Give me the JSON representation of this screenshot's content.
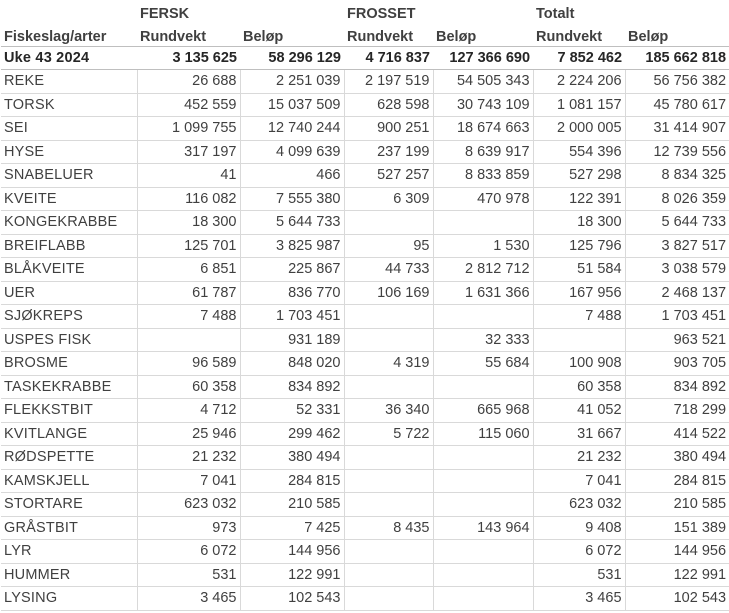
{
  "header": {
    "groups": [
      "FERSK",
      "FROSSET",
      "Totalt"
    ],
    "category_label": "Fiskeslag/arter",
    "sub_labels": [
      "Rundvekt",
      "Beløp",
      "Rundvekt",
      "Beløp",
      "Rundvekt",
      "Beløp"
    ]
  },
  "total": {
    "label": "Uke 43 2024",
    "values": [
      "3 135 625",
      "58 296 129",
      "4 716 837",
      "127 366 690",
      "7 852 462",
      "185 662 818"
    ]
  },
  "rows": [
    {
      "name": "REKE",
      "values": [
        "26 688",
        "2 251 039",
        "2 197 519",
        "54 505 343",
        "2 224 206",
        "56 756 382"
      ]
    },
    {
      "name": "TORSK",
      "values": [
        "452 559",
        "15 037 509",
        "628 598",
        "30 743 109",
        "1 081 157",
        "45 780 617"
      ]
    },
    {
      "name": "SEI",
      "values": [
        "1 099 755",
        "12 740 244",
        "900 251",
        "18 674 663",
        "2 000 005",
        "31 414 907"
      ]
    },
    {
      "name": "HYSE",
      "values": [
        "317 197",
        "4 099 639",
        "237 199",
        "8 639 917",
        "554 396",
        "12 739 556"
      ]
    },
    {
      "name": "SNABELUER",
      "values": [
        "41",
        "466",
        "527 257",
        "8 833 859",
        "527 298",
        "8 834 325"
      ]
    },
    {
      "name": "KVEITE",
      "values": [
        "116 082",
        "7 555 380",
        "6 309",
        "470 978",
        "122 391",
        "8 026 359"
      ]
    },
    {
      "name": "KONGEKRABBE",
      "values": [
        "18 300",
        "5 644 733",
        "",
        "",
        "18 300",
        "5 644 733"
      ]
    },
    {
      "name": "BREIFLABB",
      "values": [
        "125 701",
        "3 825 987",
        "95",
        "1 530",
        "125 796",
        "3 827 517"
      ]
    },
    {
      "name": "BLÅKVEITE",
      "values": [
        "6 851",
        "225 867",
        "44 733",
        "2 812 712",
        "51 584",
        "3 038 579"
      ]
    },
    {
      "name": "UER",
      "values": [
        "61 787",
        "836 770",
        "106 169",
        "1 631 366",
        "167 956",
        "2 468 137"
      ]
    },
    {
      "name": "SJØKREPS",
      "values": [
        "7 488",
        "1 703 451",
        "",
        "",
        "7 488",
        "1 703 451"
      ]
    },
    {
      "name": "USPES FISK",
      "values": [
        "",
        "931 189",
        "",
        "32 333",
        "",
        "963 521"
      ]
    },
    {
      "name": "BROSME",
      "values": [
        "96 589",
        "848 020",
        "4 319",
        "55 684",
        "100 908",
        "903 705"
      ]
    },
    {
      "name": "TASKEKRABBE",
      "values": [
        "60 358",
        "834 892",
        "",
        "",
        "60 358",
        "834 892"
      ]
    },
    {
      "name": "FLEKKSTBIT",
      "values": [
        "4 712",
        "52 331",
        "36 340",
        "665 968",
        "41 052",
        "718 299"
      ]
    },
    {
      "name": "KVITLANGE",
      "values": [
        "25 946",
        "299 462",
        "5 722",
        "115 060",
        "31 667",
        "414 522"
      ]
    },
    {
      "name": "RØDSPETTE",
      "values": [
        "21 232",
        "380 494",
        "",
        "",
        "21 232",
        "380 494"
      ]
    },
    {
      "name": "KAMSKJELL",
      "values": [
        "7 041",
        "284 815",
        "",
        "",
        "7 041",
        "284 815"
      ]
    },
    {
      "name": "STORTARE",
      "values": [
        "623 032",
        "210 585",
        "",
        "",
        "623 032",
        "210 585"
      ]
    },
    {
      "name": "GRÅSTBIT",
      "values": [
        "973",
        "7 425",
        "8 435",
        "143 964",
        "9 408",
        "151 389"
      ]
    },
    {
      "name": "LYR",
      "values": [
        "6 072",
        "144 956",
        "",
        "",
        "6 072",
        "144 956"
      ]
    },
    {
      "name": "HUMMER",
      "values": [
        "531",
        "122 991",
        "",
        "",
        "531",
        "122 991"
      ]
    },
    {
      "name": "LYSING",
      "values": [
        "3 465",
        "102 543",
        "",
        "",
        "3 465",
        "102 543"
      ]
    }
  ]
}
